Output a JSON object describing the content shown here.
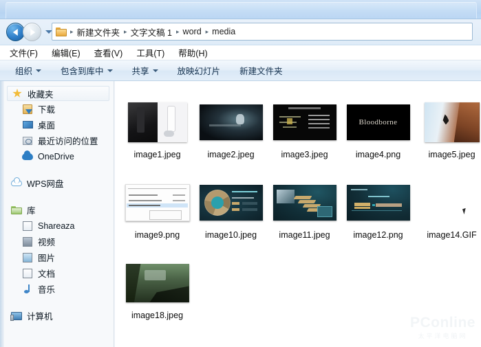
{
  "window": {
    "title": ""
  },
  "nav": {
    "back_label": "后退",
    "forward_label": "前进",
    "history_label": "最近浏览的位置",
    "breadcrumb": [
      "新建文件夹",
      "文字文稿 1",
      "word",
      "media"
    ],
    "separator": "▸"
  },
  "menubar": {
    "items": [
      {
        "label": "文件(F)"
      },
      {
        "label": "编辑(E)"
      },
      {
        "label": "查看(V)"
      },
      {
        "label": "工具(T)"
      },
      {
        "label": "帮助(H)"
      }
    ]
  },
  "toolbar": {
    "items": [
      {
        "label": "组织",
        "caret": true
      },
      {
        "label": "包含到库中",
        "caret": true
      },
      {
        "label": "共享",
        "caret": true
      },
      {
        "label": "放映幻灯片",
        "caret": false
      },
      {
        "label": "新建文件夹",
        "caret": false
      }
    ]
  },
  "sidebar": {
    "items": [
      {
        "label": "收藏夹",
        "icon": "star-icon",
        "selected": true,
        "indent": false
      },
      {
        "label": "下载",
        "icon": "downloads-icon",
        "selected": false,
        "indent": true
      },
      {
        "label": "桌面",
        "icon": "desktop-icon",
        "selected": false,
        "indent": true
      },
      {
        "label": "最近访问的位置",
        "icon": "recent-places-icon",
        "selected": false,
        "indent": true
      },
      {
        "label": "OneDrive",
        "icon": "onedrive-cloud-icon",
        "selected": false,
        "indent": true
      },
      {
        "label": "WPS网盘",
        "icon": "wps-cloud-icon",
        "selected": false,
        "indent": false
      },
      {
        "label": "库",
        "icon": "library-folder-icon",
        "selected": false,
        "indent": false
      },
      {
        "label": "Shareaza",
        "icon": "shareaza-icon",
        "selected": false,
        "indent": true
      },
      {
        "label": "视频",
        "icon": "video-icon",
        "selected": false,
        "indent": true
      },
      {
        "label": "图片",
        "icon": "pictures-icon",
        "selected": false,
        "indent": true
      },
      {
        "label": "文档",
        "icon": "documents-icon",
        "selected": false,
        "indent": true
      },
      {
        "label": "音乐",
        "icon": "music-icon",
        "selected": false,
        "indent": true
      },
      {
        "label": "计算机",
        "icon": "computer-icon",
        "selected": false,
        "indent": false
      }
    ]
  },
  "files": [
    {
      "name": "image1.jpeg",
      "thumb": "consoles"
    },
    {
      "name": "image2.jpeg",
      "thumb": "dark-scene"
    },
    {
      "name": "image3.jpeg",
      "thumb": "dark-chart"
    },
    {
      "name": "image4.png",
      "thumb": "bloodborne-title",
      "thumb_text": "Bloodborne"
    },
    {
      "name": "image5.jpeg",
      "thumb": "climber"
    },
    {
      "name": "image9.png",
      "thumb": "file-list"
    },
    {
      "name": "image10.jpeg",
      "thumb": "teal-dial"
    },
    {
      "name": "image11.jpeg",
      "thumb": "teal-steps"
    },
    {
      "name": "image12.png",
      "thumb": "teal-bars"
    },
    {
      "name": "image14.GIF",
      "thumb": "none"
    },
    {
      "name": "image18.jpeg",
      "thumb": "jungle"
    }
  ],
  "watermark": {
    "main": "PConline",
    "sub": "太平洋电脑网"
  },
  "colors": {
    "accent": "#2f7fc9",
    "titlebar": "#c2daf3",
    "toolbar": "#e4eef8",
    "sidebar_bg": "#f7f9fb",
    "content_bg": "#ffffff"
  }
}
